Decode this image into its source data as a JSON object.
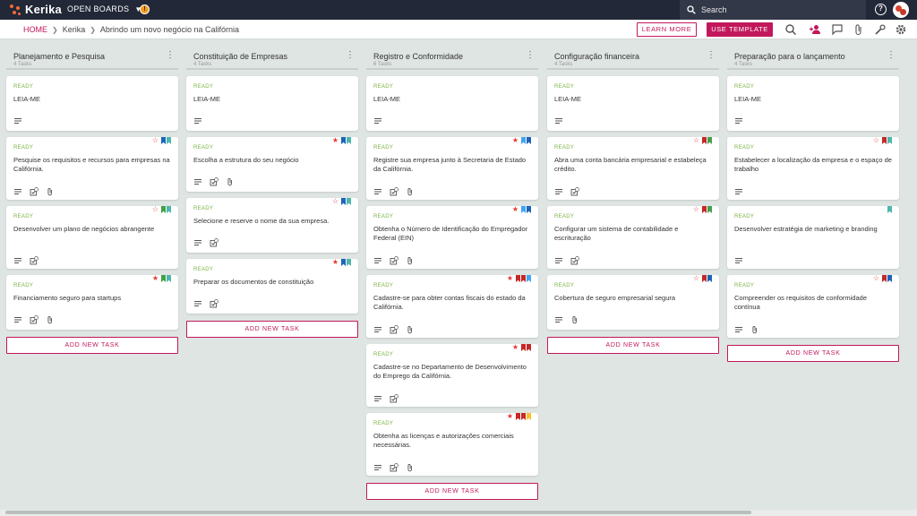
{
  "app": {
    "logo_text": "Kerika",
    "open_boards_label": "OPEN BOARDS",
    "search_label": "Search"
  },
  "breadcrumb": {
    "home": "HOME",
    "org": "Kerika",
    "board": "Abrindo um novo negócio na Califórnia"
  },
  "actions": {
    "learn_more": "LEARN MORE",
    "use_template": "USE TEMPLATE"
  },
  "colors": {
    "accent": "#c2185b",
    "ready": "#7cb342",
    "red_star": "#e53935",
    "flag_blue": "#1e63b8",
    "flag_teal": "#4db6ac",
    "flag_green": "#43a047",
    "flag_red": "#c62828",
    "flag_lightblue": "#42a5f5",
    "flag_yellow": "#fbc02d"
  },
  "add_task_label": "ADD NEW TASK",
  "columns": [
    {
      "title": "Planejamento e Pesquisa",
      "count": "4 Tasks",
      "cards": [
        {
          "status": "READY",
          "title": "LEIA-ME",
          "icons": [
            "desc"
          ],
          "star": "",
          "flags": []
        },
        {
          "status": "READY",
          "title": "Pesquise os requisitos e recursos para empresas na Califórnia.",
          "icons": [
            "desc",
            "check",
            "attach"
          ],
          "star": "outline",
          "flags": [
            "blue",
            "teal"
          ]
        },
        {
          "status": "READY",
          "title": "Desenvolver um plano de negócios abrangente",
          "icons": [
            "desc",
            "check"
          ],
          "star": "outline",
          "flags": [
            "green",
            "teal"
          ]
        },
        {
          "status": "READY",
          "title": "Financiamento seguro para startups",
          "icons": [
            "desc",
            "check",
            "attach"
          ],
          "star": "filled",
          "flags": [
            "green",
            "teal"
          ]
        }
      ]
    },
    {
      "title": "Constituição de Empresas",
      "count": "4 Tasks",
      "cards": [
        {
          "status": "READY",
          "title": "LEIA-ME",
          "icons": [
            "desc"
          ],
          "star": "",
          "flags": []
        },
        {
          "status": "READY",
          "title": "Escolha a estrutura do seu negócio",
          "icons": [
            "desc",
            "check",
            "attach"
          ],
          "star": "filled",
          "flags": [
            "blue",
            "teal"
          ]
        },
        {
          "status": "READY",
          "title": "Selecione e reserve o nome da sua empresa.",
          "icons": [
            "desc",
            "check"
          ],
          "star": "outline",
          "flags": [
            "blue",
            "teal"
          ]
        },
        {
          "status": "READY",
          "title": "Preparar os documentos de constituição",
          "icons": [
            "desc",
            "check"
          ],
          "star": "filled",
          "flags": [
            "blue",
            "teal"
          ]
        }
      ]
    },
    {
      "title": "Registro e Conformidade",
      "count": "6 Tasks",
      "cards": [
        {
          "status": "READY",
          "title": "LEIA-ME",
          "icons": [
            "desc"
          ],
          "star": "",
          "flags": []
        },
        {
          "status": "READY",
          "title": "Registre sua empresa junto à Secretaria de Estado da Califórnia.",
          "icons": [
            "desc",
            "check",
            "attach"
          ],
          "star": "filled",
          "flags": [
            "lightblue",
            "blue"
          ]
        },
        {
          "status": "READY",
          "title": "Obtenha o Número de Identificação do Empregador Federal (EIN)",
          "icons": [
            "desc",
            "check",
            "attach"
          ],
          "star": "filled",
          "flags": [
            "lightblue",
            "blue"
          ]
        },
        {
          "status": "READY",
          "title": "Cadastre-se para obter contas fiscais do estado da Califórnia.",
          "icons": [
            "desc",
            "check",
            "attach"
          ],
          "star": "filled",
          "flags": [
            "red",
            "red",
            "lightblue"
          ]
        },
        {
          "status": "READY",
          "title": "Cadastre-se no Departamento de Desenvolvimento do Emprego da Califórnia.",
          "icons": [
            "desc",
            "check"
          ],
          "star": "filled",
          "flags": [
            "red",
            "red"
          ]
        },
        {
          "status": "READY",
          "title": "Obtenha as licenças e autorizações comerciais necessárias.",
          "icons": [
            "desc",
            "check",
            "attach"
          ],
          "star": "filled",
          "flags": [
            "red",
            "red",
            "yellow"
          ]
        }
      ]
    },
    {
      "title": "Configuração financeira",
      "count": "4 Tasks",
      "cards": [
        {
          "status": "READY",
          "title": "LEIA-ME",
          "icons": [
            "desc"
          ],
          "star": "",
          "flags": []
        },
        {
          "status": "READY",
          "title": "Abra uma conta bancária empresarial e estabeleça crédito.",
          "icons": [
            "desc",
            "check"
          ],
          "star": "outline",
          "flags": [
            "red",
            "green"
          ]
        },
        {
          "status": "READY",
          "title": "Configurar um sistema de contabilidade e escrituração",
          "icons": [
            "desc",
            "check"
          ],
          "star": "outline",
          "flags": [
            "red",
            "green"
          ]
        },
        {
          "status": "READY",
          "title": "Cobertura de seguro empresarial segura",
          "icons": [
            "desc",
            "attach"
          ],
          "star": "outline",
          "flags": [
            "red",
            "blue"
          ]
        }
      ]
    },
    {
      "title": "Preparação para o lançamento",
      "count": "4 Tasks",
      "cards": [
        {
          "status": "READY",
          "title": "LEIA-ME",
          "icons": [
            "desc"
          ],
          "star": "",
          "flags": []
        },
        {
          "status": "READY",
          "title": "Estabelecer a localização da empresa e o espaço de trabalho",
          "icons": [
            "desc"
          ],
          "star": "outline",
          "flags": [
            "red",
            "teal"
          ]
        },
        {
          "status": "READY",
          "title": "Desenvolver estratégia de marketing e branding",
          "icons": [
            "desc"
          ],
          "star": "",
          "flags": [
            "teal"
          ]
        },
        {
          "status": "READY",
          "title": "Compreender os requisitos de conformidade contínua",
          "icons": [
            "desc",
            "attach"
          ],
          "star": "outline",
          "flags": [
            "red",
            "blue"
          ]
        }
      ]
    }
  ]
}
